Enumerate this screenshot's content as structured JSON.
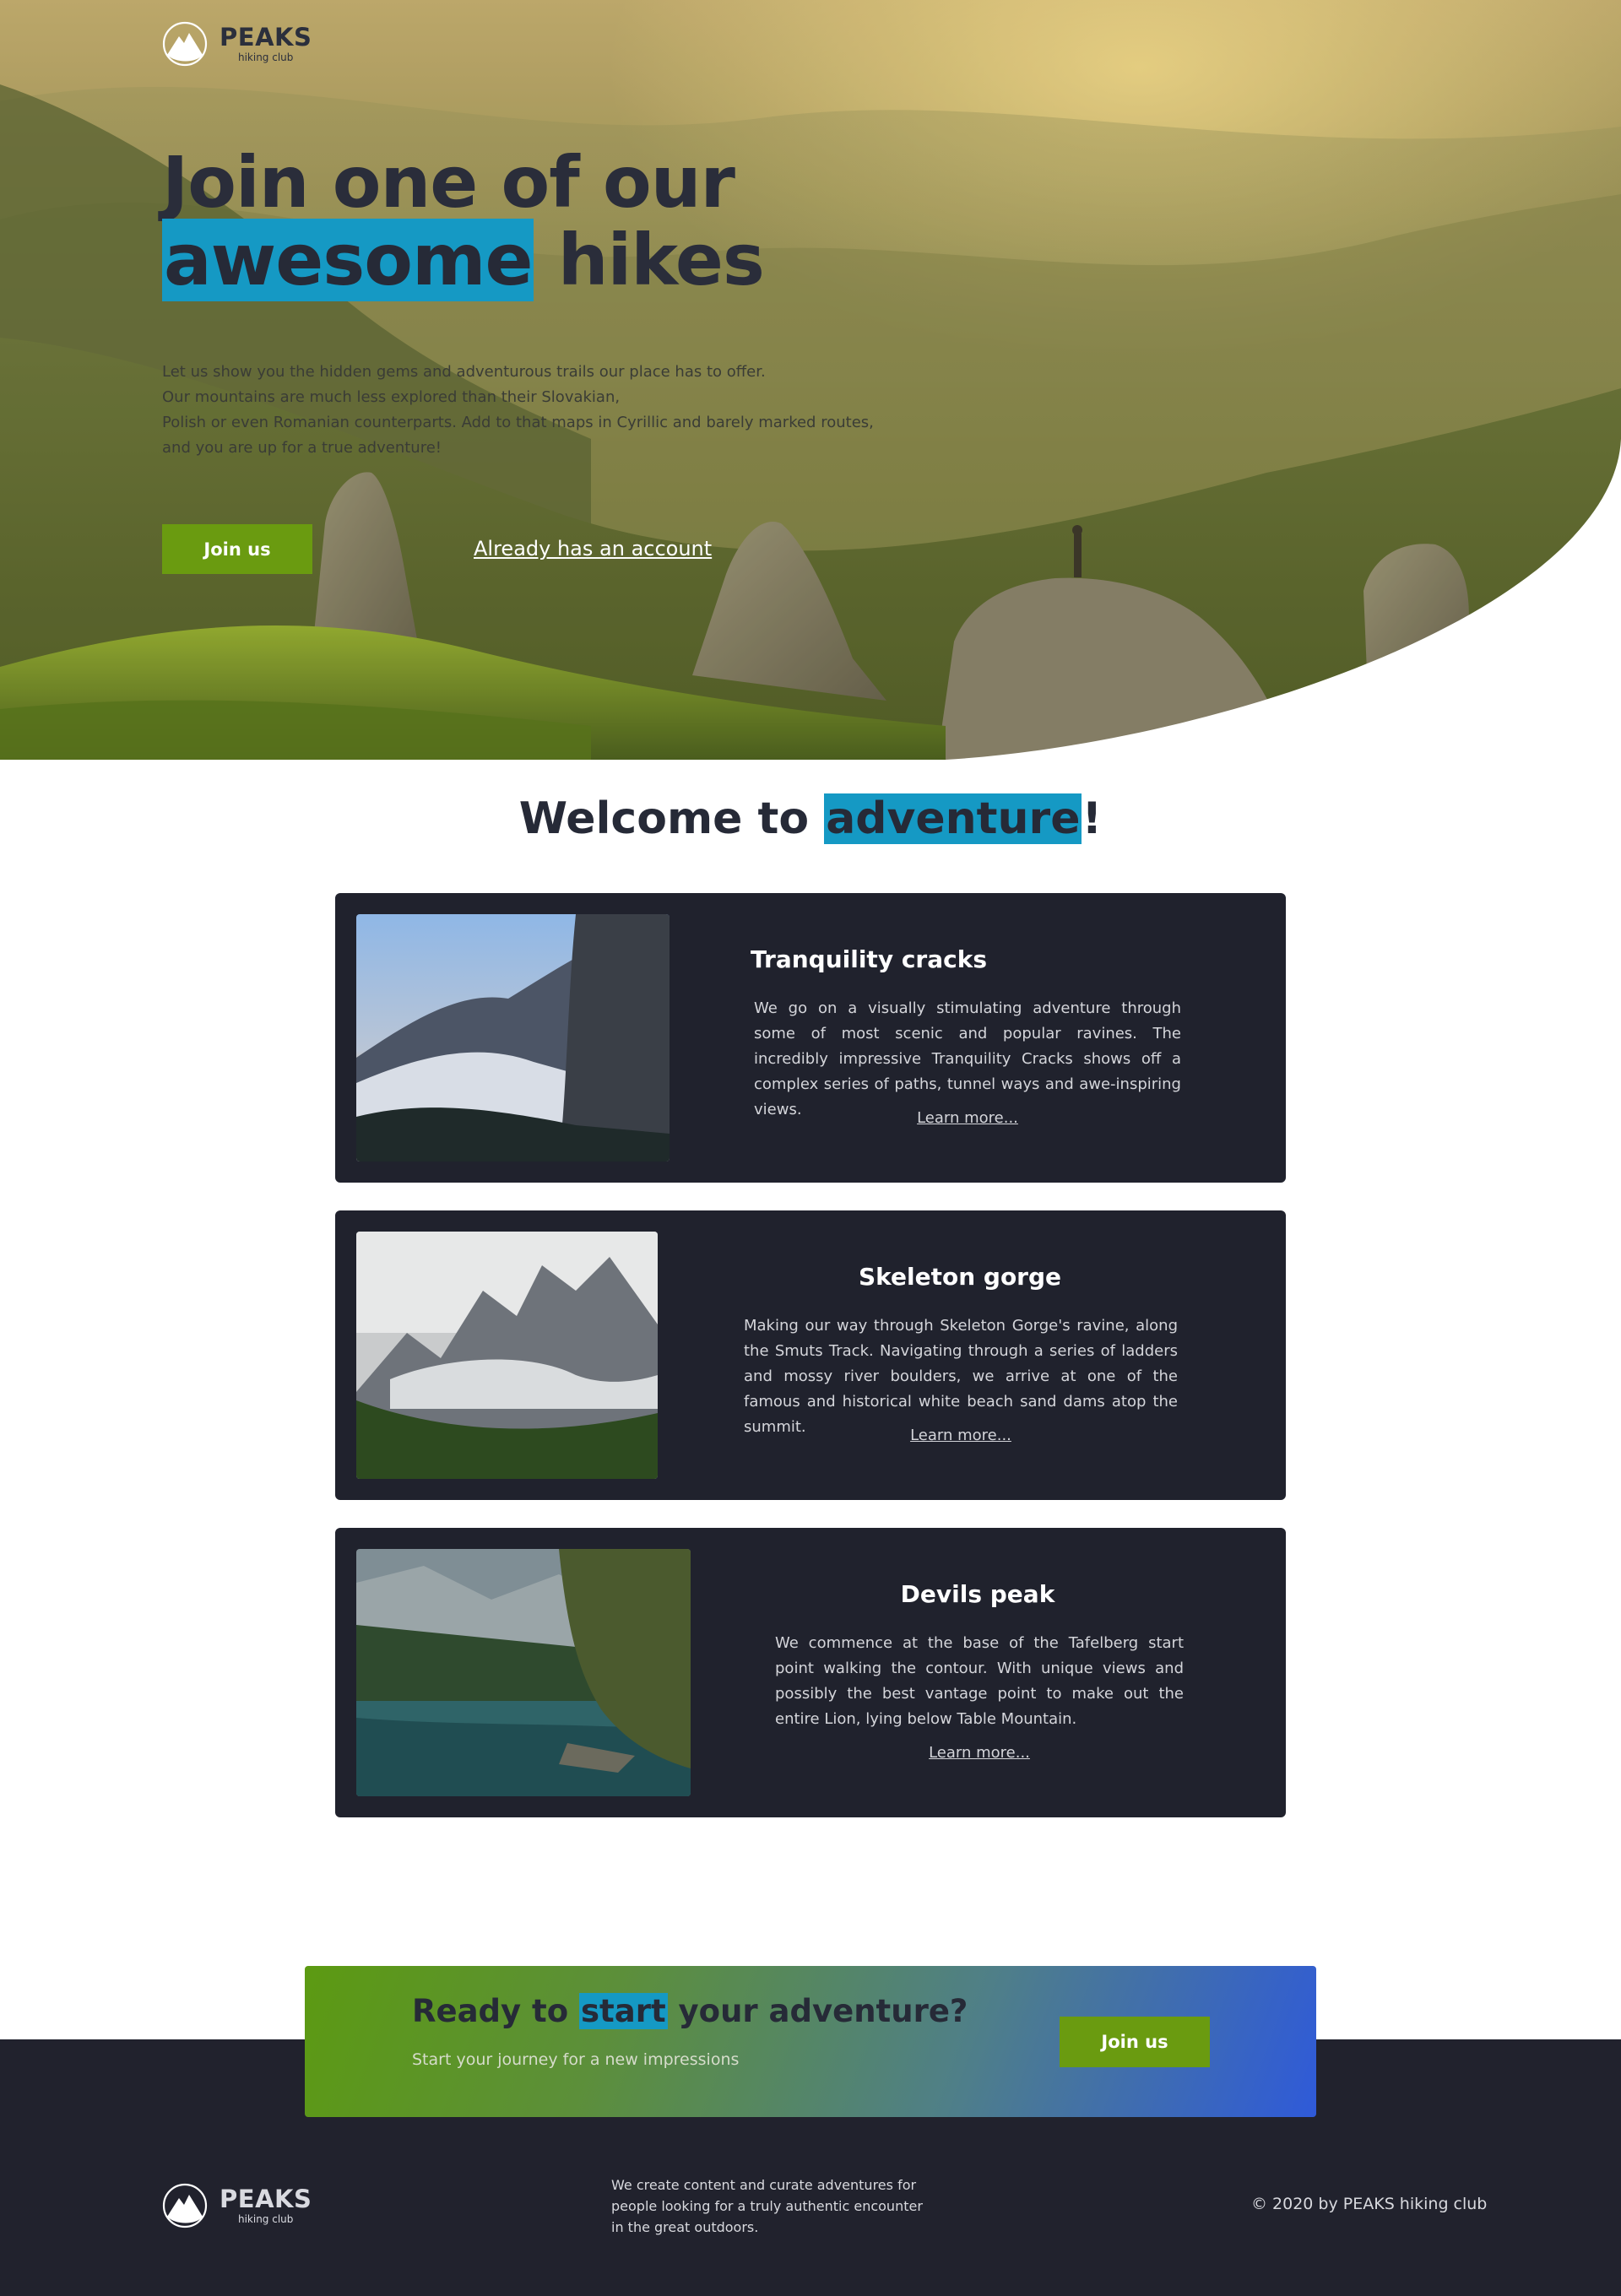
{
  "brand": {
    "name": "PEAKS",
    "tagline": "hiking club"
  },
  "hero": {
    "title_line1": "Join one of our",
    "title_highlight": "awesome",
    "title_rest": " hikes",
    "paragraph_lines": [
      "Let us show you the hidden gems and adventurous trails our place has to offer.",
      "Our mountains are much less explored than their Slovakian,",
      "Polish or even Romanian counterparts. Add to that maps in Cyrillic and barely marked routes,",
      "and you are up for a true adventure!"
    ],
    "join_label": "Join us",
    "account_link": "Already has an account"
  },
  "welcome": {
    "prefix": "Welcome to ",
    "highlight": "adventure",
    "suffix": "!"
  },
  "hikes": [
    {
      "title": "Tranquility cracks",
      "description": "We go on a visually stimulating adventure through some of most scenic and popular ravines. The incredibly impressive Tranquility Cracks shows off a complex series of paths, tunnel ways and awe-inspiring views.",
      "link": "Learn more..."
    },
    {
      "title": "Skeleton gorge",
      "description": "Making our way through Skeleton Gorge's ravine, along the Smuts Track. Navigating through a series of ladders and mossy river boulders, we arrive at one of the famous and historical white beach sand dams atop the summit.",
      "link": "Learn more..."
    },
    {
      "title": "Devils peak",
      "description": "We commence at the base of the Tafelberg start point walking the contour. With unique views and possibly the best vantage point to make out the entire Lion, lying below Table Mountain.",
      "link": "Learn more..."
    }
  ],
  "cta": {
    "prefix": "Ready to ",
    "highlight": "start",
    "suffix": " your adventure?",
    "subtitle": "Start your journey for a new impressions",
    "button_label": "Join us"
  },
  "footer": {
    "description": "We create content and curate adventures for people looking for a truly authentic encounter in the great outdoors.",
    "copyright": "© 2020 by PEAKS hiking club"
  },
  "colors": {
    "accent_blue": "#1599c4",
    "button_green": "#6a9b10",
    "dark_navy": "#20222d",
    "heading": "#262a37"
  }
}
